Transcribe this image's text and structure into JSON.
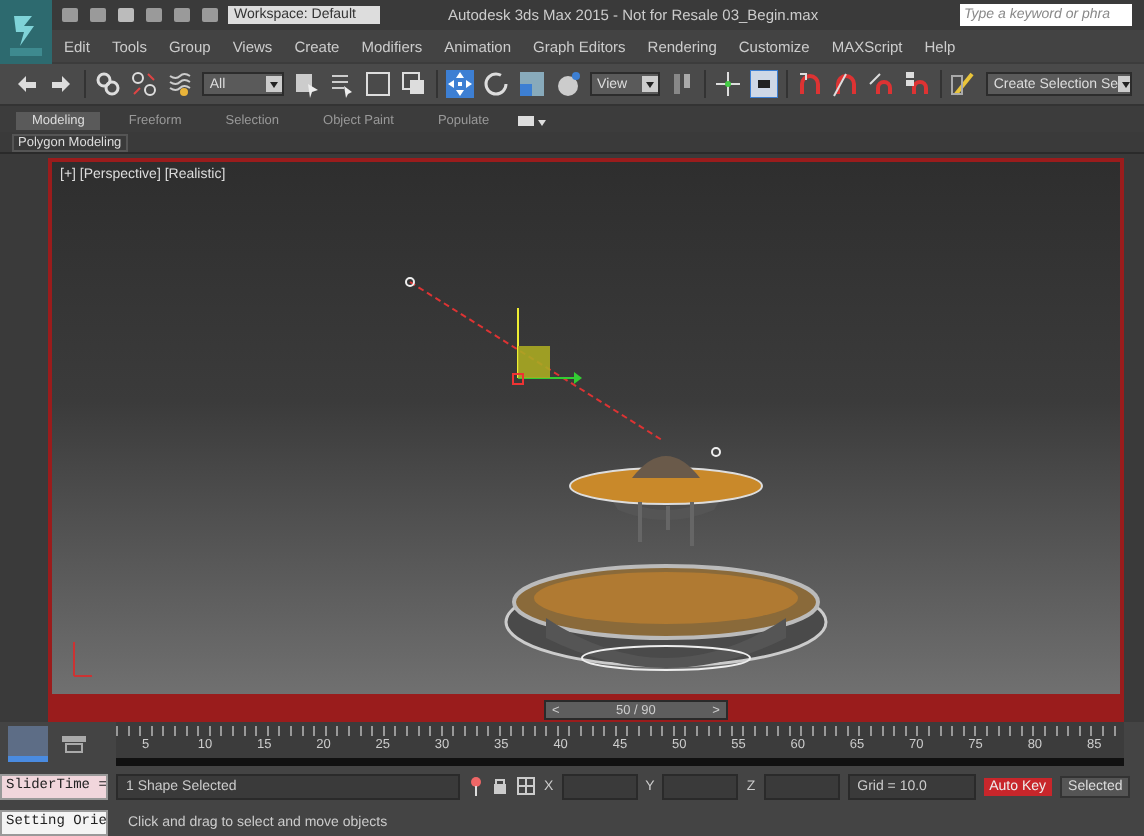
{
  "title_bar": {
    "workspace": "Workspace: Default",
    "title": "Autodesk 3ds Max 2015  - Not for Resale   03_Begin.max",
    "search": {
      "placeholder": "Type a keyword or phra"
    }
  },
  "menu": [
    "Edit",
    "Tools",
    "Group",
    "Views",
    "Create",
    "Modifiers",
    "Animation",
    "Graph Editors",
    "Rendering",
    "Customize",
    "MAXScript",
    "Help"
  ],
  "toolbar": {
    "selection_filter": "All",
    "reference_coord": "View",
    "named_selection": "Create Selection Se"
  },
  "ribbon": {
    "tabs": [
      {
        "label": "Modeling",
        "selected": true
      },
      {
        "label": "Freeform",
        "selected": false
      },
      {
        "label": "Selection",
        "selected": false
      },
      {
        "label": "Object Paint",
        "selected": false
      },
      {
        "label": "Populate",
        "selected": false
      }
    ],
    "panel": "Polygon Modeling"
  },
  "viewport": {
    "label": "[+] [Perspective] [Realistic]",
    "active": true
  },
  "time_slider": {
    "prev": "<",
    "reading": "50 / 90",
    "next": ">",
    "level": 0.556
  },
  "track_bar": {
    "ticks": [
      "5",
      "10",
      "15",
      "20",
      "25",
      "30",
      "35",
      "40",
      "45",
      "50",
      "55",
      "60",
      "65",
      "70",
      "75",
      "80",
      "85"
    ]
  },
  "status": {
    "listener": [
      "SliderTime =",
      "Setting Orie"
    ],
    "selection": "1 Shape Selected",
    "prompt": "Click and drag to select and move objects",
    "coords": [
      {
        "axis": "X"
      },
      {
        "axis": "Y"
      },
      {
        "axis": "Z"
      }
    ],
    "grid": "Grid = 10.0",
    "auto_key": {
      "label": "Auto Key",
      "on": true
    },
    "key_filter": "Selected"
  }
}
